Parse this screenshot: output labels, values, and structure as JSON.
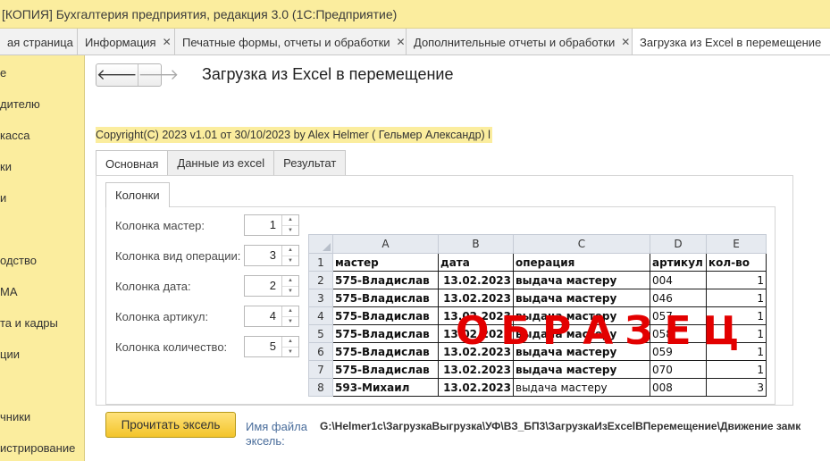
{
  "window": {
    "title": "[КОПИЯ] Бухгалтерия предприятия, редакция 3.0  (1С:Предприятие)"
  },
  "tabs": [
    {
      "label": "ая страница",
      "closable": false
    },
    {
      "label": "Информация",
      "closable": true
    },
    {
      "label": "Печатные формы, отчеты и обработки",
      "closable": true
    },
    {
      "label": "Дополнительные отчеты и обработки",
      "closable": true
    },
    {
      "label": "Загрузка из Excel в перемещение",
      "closable": false
    }
  ],
  "sidebar": {
    "items": [
      "е",
      "дителю",
      "касса",
      "ки",
      "и",
      "одство",
      "МА",
      "та и кадры",
      "ции",
      "чники",
      "истрирование"
    ]
  },
  "form": {
    "title": "Загрузка из Excel в перемещение",
    "copyright": "Copyright(C)  2023 v1.01 от 30/10/2023  by Alex Helmer ( Гельмер Александр) l",
    "page_tabs": [
      "Основная",
      "Данные из excel",
      "Результат"
    ],
    "inner_tab": "Колонки",
    "fields": [
      {
        "label": "Колонка мастер:",
        "value": "1"
      },
      {
        "label": "Колонка вид операции:",
        "value": "3"
      },
      {
        "label": "Колонка дата:",
        "value": "2"
      },
      {
        "label": "Колонка артикул:",
        "value": "4"
      },
      {
        "label": "Колонка количество:",
        "value": "5"
      }
    ],
    "read_button": "Прочитать эксель",
    "filename_label": "Имя файла эксель:",
    "filename_value": "G:\\Helmer1c\\ЗагрузкаВыгрузка\\УФ\\ВЗ_БП3\\ЗагрузкаИзExcelВПеремещение\\Движение замк"
  },
  "excel_sample": {
    "col_letters": [
      "A",
      "B",
      "C",
      "D",
      "E"
    ],
    "rows": [
      {
        "n": "1",
        "cells": [
          "мастер",
          "дата",
          "операция",
          "артикул",
          "кол-во"
        ]
      },
      {
        "n": "2",
        "cells": [
          "575-Владислав",
          "13.02.2023",
          "выдача мастеру",
          "004",
          "1"
        ]
      },
      {
        "n": "3",
        "cells": [
          "575-Владислав",
          "13.02.2023",
          "выдача мастеру",
          "046",
          "1"
        ]
      },
      {
        "n": "4",
        "cells": [
          "575-Владислав",
          "13.02.2023",
          "выдача мастеру",
          "057",
          "1"
        ]
      },
      {
        "n": "5",
        "cells": [
          "575-Владислав",
          "13.02.2023",
          "выдача мастеру",
          "058",
          "1"
        ]
      },
      {
        "n": "6",
        "cells": [
          "575-Владислав",
          "13.02.2023",
          "выдача мастеру",
          "059",
          "1"
        ]
      },
      {
        "n": "7",
        "cells": [
          "575-Владислав",
          "13.02.2023",
          "выдача мастеру",
          "070",
          "1"
        ]
      },
      {
        "n": "8",
        "cells": [
          "593-Михаил",
          "13.02.2023",
          "выдача мастеру",
          "008",
          "3"
        ]
      }
    ],
    "watermark": "ОБРАЗЕЦ"
  }
}
